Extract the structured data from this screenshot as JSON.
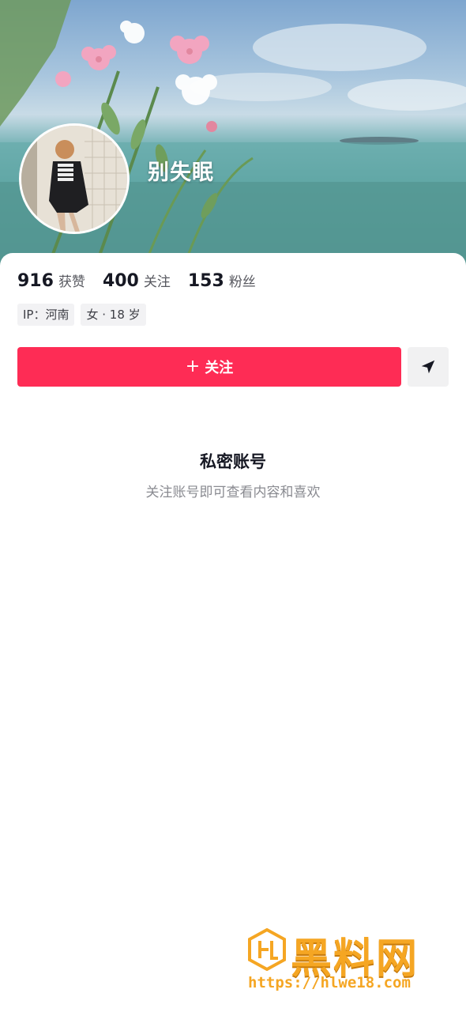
{
  "profile": {
    "nickname": "别失眠"
  },
  "stats": [
    {
      "value": "916",
      "label": "获赞"
    },
    {
      "value": "400",
      "label": "关注"
    },
    {
      "value": "153",
      "label": "粉丝"
    }
  ],
  "tags": [
    {
      "text": "IP：河南"
    },
    {
      "text": "女 · 18 岁"
    }
  ],
  "actions": {
    "follow_icon": "+",
    "follow_label": "关注",
    "share_icon": "send-icon"
  },
  "private": {
    "title": "私密账号",
    "subtitle": "关注账号即可查看内容和喜欢"
  },
  "watermark": {
    "brand": "黑料网",
    "url": "https://hlwe18.com"
  },
  "colors": {
    "accent": "#fe2c55",
    "watermark": "#f5a623"
  }
}
